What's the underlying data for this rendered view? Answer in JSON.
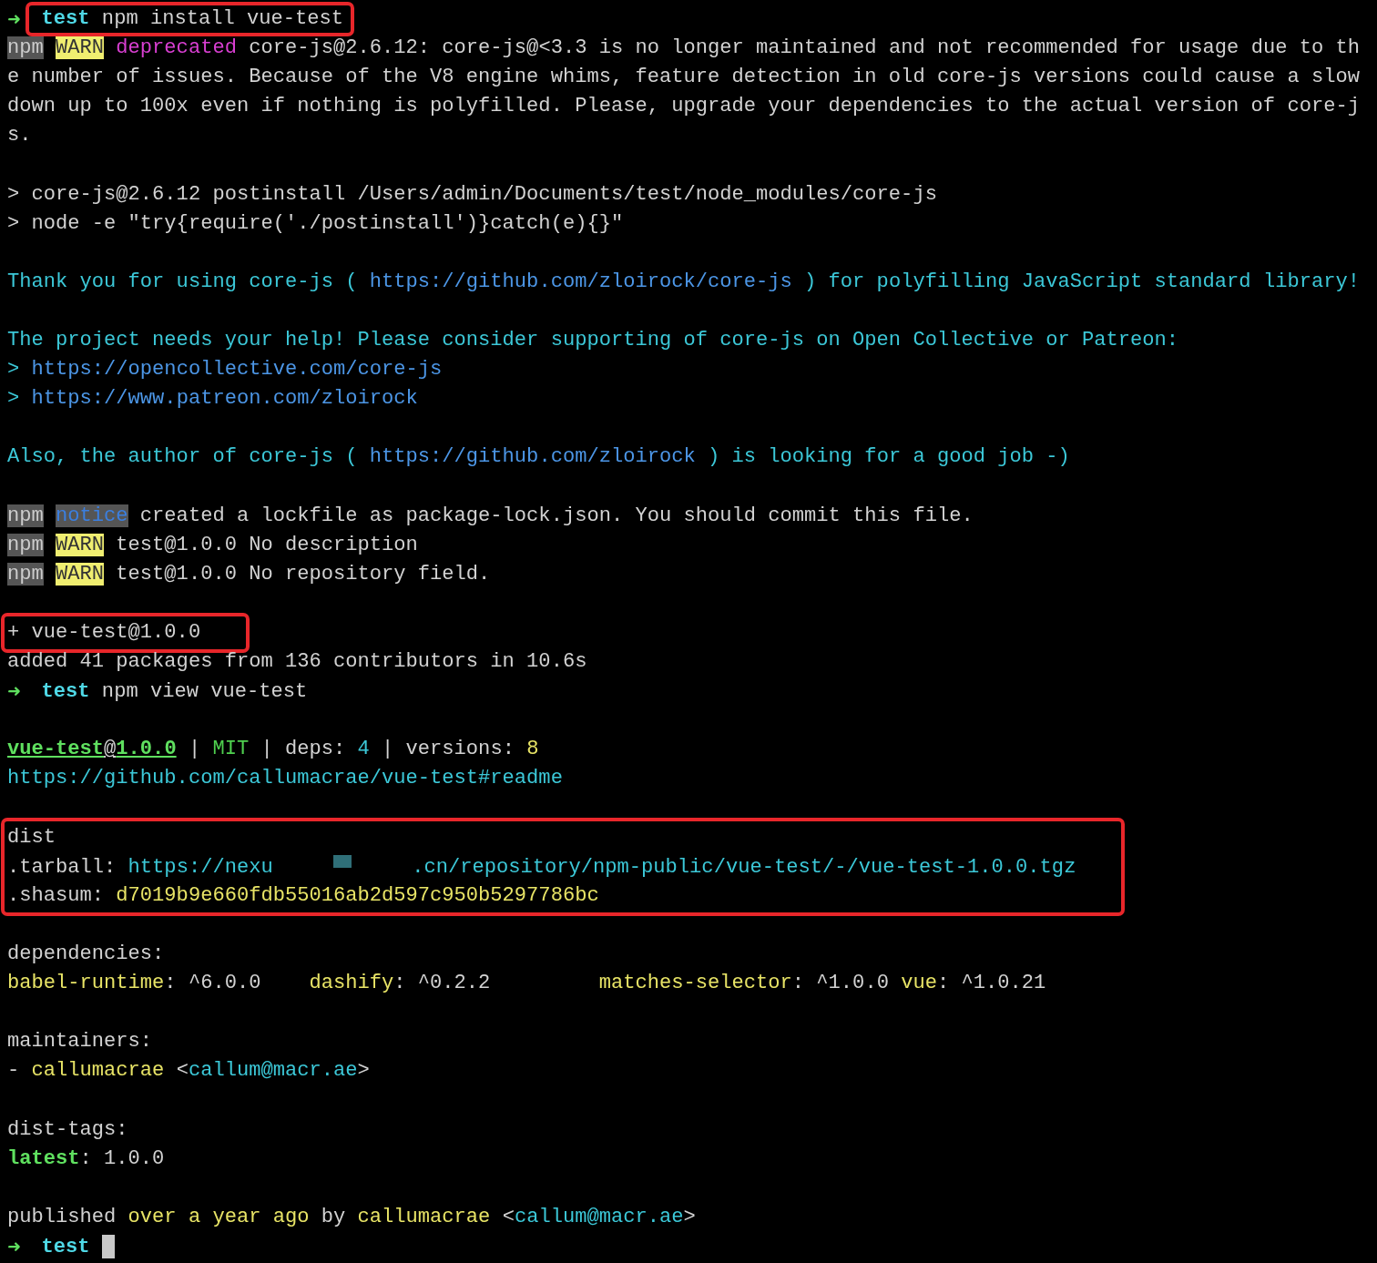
{
  "terminal": {
    "blocks": [
      {
        "lines": [
          {
            "highlighted": true,
            "segments": [
              {
                "kind": "arrow",
                "text": "➜"
              },
              {
                "kind": "dir",
                "text": "test"
              },
              {
                "kind": "text",
                "text": " npm install vue-test"
              }
            ]
          },
          {
            "highlighted": false,
            "segments": [
              {
                "kind": "npm",
                "text": "npm"
              },
              {
                "kind": "warn",
                "text": "WARN"
              },
              {
                "kind": "deprecated",
                "text": "deprecated"
              },
              {
                "kind": "text",
                "text": " core-js@2.6.12: core-js@<3.3 is no longer maintained and not recommended for usage due to th"
              }
            ]
          },
          {
            "highlighted": false,
            "segments": [
              {
                "kind": "text",
                "text": "e number of issues. Because of the V8 engine whims, feature detection in old core-js versions could cause a slow"
              }
            ]
          },
          {
            "highlighted": false,
            "segments": [
              {
                "kind": "text",
                "text": "down up to 100x even if nothing is polyfilled. Please, upgrade your dependencies to the actual version of core-j"
              }
            ]
          },
          {
            "highlighted": false,
            "segments": [
              {
                "kind": "text",
                "text": "s."
              }
            ]
          }
        ]
      },
      {
        "lines": [
          {
            "highlighted": false,
            "segments": [
              {
                "kind": "text",
                "text": "> core-js@2.6.12 postinstall /Users/admin/Documents/test/node_modules/core-js"
              }
            ]
          },
          {
            "highlighted": false,
            "segments": [
              {
                "kind": "text",
                "text": "> node -e \"try{require('./postinstall')}catch(e){}\""
              }
            ]
          }
        ]
      },
      {
        "lines": [
          {
            "highlighted": false,
            "segments": [
              {
                "kind": "cyan",
                "text": "Thank you for using core-js ( "
              },
              {
                "kind": "link",
                "text": "https://github.com/zloirock/core-js"
              },
              {
                "kind": "cyan",
                "text": " ) for polyfilling JavaScript standard library!"
              }
            ]
          }
        ]
      },
      {
        "lines": [
          {
            "highlighted": false,
            "segments": [
              {
                "kind": "cyan",
                "text": "The project needs your help! Please consider supporting of core-js on Open Collective or Patreon:"
              }
            ]
          },
          {
            "highlighted": false,
            "segments": [
              {
                "kind": "cyan",
                "text": "> "
              },
              {
                "kind": "link",
                "text": "https://opencollective.com/core-js"
              }
            ]
          },
          {
            "highlighted": false,
            "segments": [
              {
                "kind": "cyan",
                "text": "> "
              },
              {
                "kind": "link",
                "text": "https://www.patreon.com/zloirock"
              }
            ]
          }
        ]
      },
      {
        "lines": [
          {
            "highlighted": false,
            "segments": [
              {
                "kind": "cyan",
                "text": "Also, the author of core-js ( "
              },
              {
                "kind": "link",
                "text": "https://github.com/zloirock"
              },
              {
                "kind": "cyan",
                "text": " ) is looking for a good job -)"
              }
            ]
          }
        ]
      },
      {
        "lines": [
          {
            "highlighted": false,
            "segments": [
              {
                "kind": "npm",
                "text": "npm"
              },
              {
                "kind": "notice",
                "text": "notice"
              },
              {
                "kind": "text",
                "text": "created a lockfile as package-lock.json. You should commit this file."
              }
            ]
          },
          {
            "highlighted": false,
            "segments": [
              {
                "kind": "npm",
                "text": "npm"
              },
              {
                "kind": "warn",
                "text": "WARN"
              },
              {
                "kind": "text",
                "text": "test@1.0.0 No description"
              }
            ]
          },
          {
            "highlighted": false,
            "segments": [
              {
                "kind": "npm",
                "text": "npm"
              },
              {
                "kind": "warn",
                "text": "WARN"
              },
              {
                "kind": "text",
                "text": "test@1.0.0 No repository field."
              }
            ]
          }
        ]
      },
      {
        "lines": [
          {
            "highlighted": true,
            "segments": [
              {
                "kind": "text",
                "text": "+ vue-test@1.0.0"
              }
            ]
          },
          {
            "highlighted": false,
            "segments": [
              {
                "kind": "text",
                "text": "added 41 packages from 136 contributors in 10.6s"
              }
            ]
          },
          {
            "highlighted": false,
            "segments": [
              {
                "kind": "arrow",
                "text": "➜"
              },
              {
                "kind": "dir",
                "text": "test"
              },
              {
                "kind": "text",
                "text": " npm view vue-test"
              }
            ]
          }
        ]
      },
      {
        "lines": [
          {
            "highlighted": false,
            "segments": [
              {
                "kind": "pkg",
                "text": "vue-test"
              },
              {
                "kind": "at",
                "text": "@"
              },
              {
                "kind": "pkg",
                "text": "1.0.0"
              },
              {
                "kind": "text",
                "text": " | "
              },
              {
                "kind": "green",
                "text": "MIT"
              },
              {
                "kind": "text",
                "text": " | deps: "
              },
              {
                "kind": "cyan",
                "text": "4"
              },
              {
                "kind": "text",
                "text": " | versions: "
              },
              {
                "kind": "yellow",
                "text": "8"
              }
            ]
          },
          {
            "highlighted": false,
            "segments": [
              {
                "kind": "cyan",
                "text": "https://github.com/callumacrae/vue-test#readme"
              }
            ]
          }
        ]
      },
      {
        "lines": [
          {
            "highlighted": true,
            "segments": [
              {
                "kind": "text",
                "text": "dist"
              }
            ]
          },
          {
            "highlighted": true,
            "segments": [
              {
                "kind": "text",
                "text": ".tarball: "
              },
              {
                "kind": "cyan",
                "text": "https://nexu"
              },
              {
                "kind": "redacted"
              },
              {
                "kind": "cyan",
                "text": ".cn/repository/npm-public/vue-test/-/vue-test-1.0.0.tgz"
              }
            ]
          },
          {
            "highlighted": true,
            "segments": [
              {
                "kind": "text",
                "text": ".shasum: "
              },
              {
                "kind": "yellow",
                "text": "d7019b9e660fdb55016ab2d597c950b5297786bc"
              }
            ]
          }
        ]
      },
      {
        "lines": [
          {
            "highlighted": false,
            "segments": [
              {
                "kind": "text",
                "text": "dependencies:"
              }
            ]
          },
          {
            "highlighted": false,
            "segments": [
              {
                "kind": "yellow",
                "text": "babel-runtime"
              },
              {
                "kind": "text",
                "text": ": ^6.0.0    "
              },
              {
                "kind": "yellow",
                "text": "dashify"
              },
              {
                "kind": "text",
                "text": ": ^0.2.2         "
              },
              {
                "kind": "yellow",
                "text": "matches-selector"
              },
              {
                "kind": "text",
                "text": ": ^1.0.0 "
              },
              {
                "kind": "yellow",
                "text": "vue"
              },
              {
                "kind": "text",
                "text": ": ^1.0.21"
              }
            ]
          }
        ]
      },
      {
        "lines": [
          {
            "highlighted": false,
            "segments": [
              {
                "kind": "text",
                "text": "maintainers:"
              }
            ]
          },
          {
            "highlighted": false,
            "segments": [
              {
                "kind": "text",
                "text": "- "
              },
              {
                "kind": "yellow",
                "text": "callumacrae"
              },
              {
                "kind": "text",
                "text": " <"
              },
              {
                "kind": "cyan",
                "text": "callum@macr.ae"
              },
              {
                "kind": "text",
                "text": ">"
              }
            ]
          }
        ]
      },
      {
        "lines": [
          {
            "highlighted": false,
            "segments": [
              {
                "kind": "text",
                "text": "dist-tags:"
              }
            ]
          },
          {
            "highlighted": false,
            "segments": [
              {
                "kind": "key",
                "text": "latest"
              },
              {
                "kind": "text",
                "text": ": 1.0.0"
              }
            ]
          }
        ]
      },
      {
        "lines": [
          {
            "highlighted": false,
            "segments": [
              {
                "kind": "text",
                "text": "published "
              },
              {
                "kind": "yellow",
                "text": "over a year ago"
              },
              {
                "kind": "text",
                "text": " by "
              },
              {
                "kind": "yellow",
                "text": "callumacrae"
              },
              {
                "kind": "text",
                "text": " <"
              },
              {
                "kind": "cyan",
                "text": "callum@macr.ae"
              },
              {
                "kind": "text",
                "text": ">"
              }
            ]
          },
          {
            "highlighted": false,
            "segments": [
              {
                "kind": "arrow",
                "text": "➜"
              },
              {
                "kind": "dir",
                "text": "test"
              },
              {
                "kind": "cursor"
              }
            ]
          }
        ]
      }
    ]
  }
}
